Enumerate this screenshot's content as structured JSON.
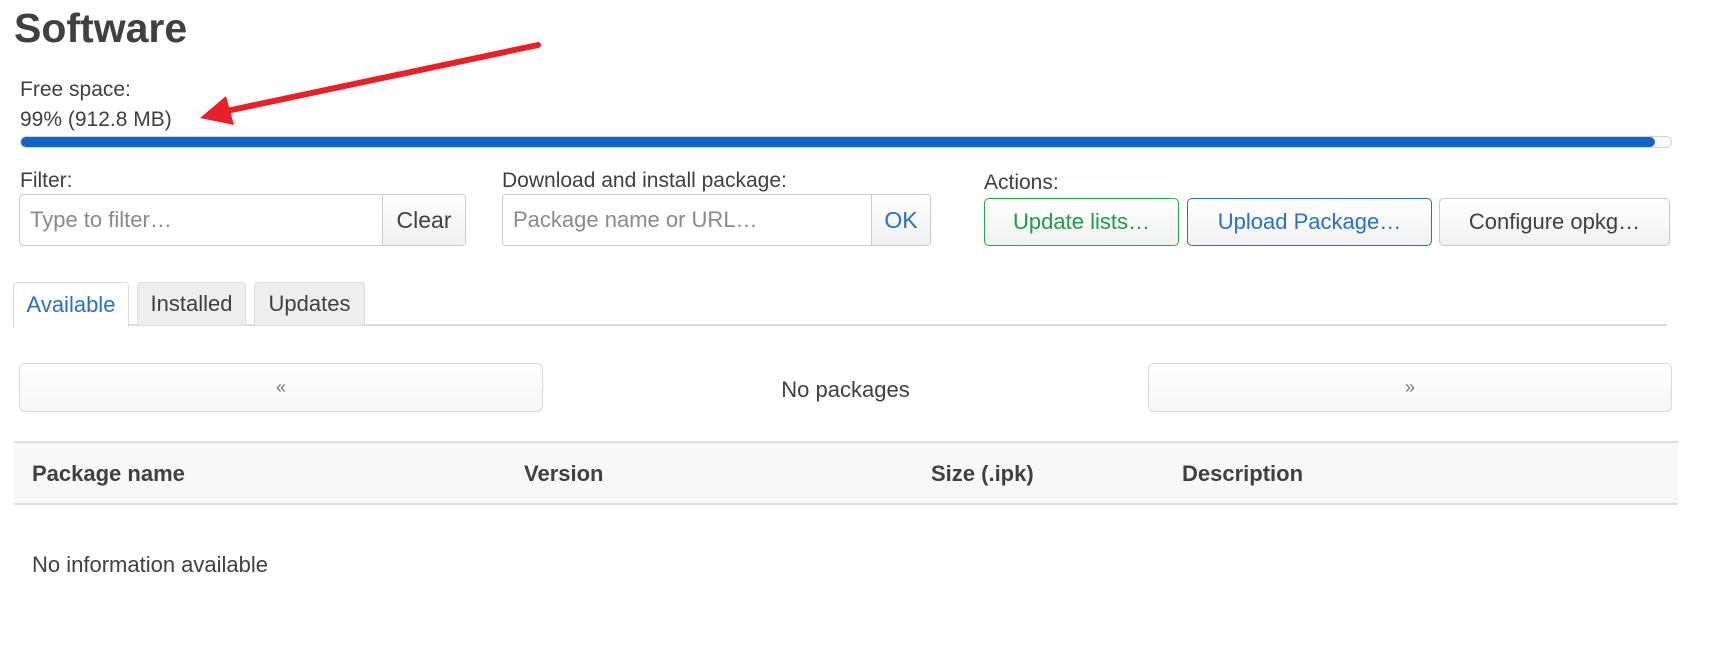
{
  "page": {
    "title": "Software"
  },
  "free_space": {
    "label": "Free space:",
    "value_text": "99% (912.8 MB)",
    "percent": 99,
    "bar_color": "#1565c0"
  },
  "filter": {
    "label": "Filter:",
    "placeholder": "Type to filter…",
    "value": "",
    "clear_label": "Clear"
  },
  "download": {
    "label": "Download and install package:",
    "placeholder": "Package name or URL…",
    "value": "",
    "ok_label": "OK"
  },
  "actions": {
    "label": "Actions:",
    "buttons": [
      {
        "label": "Update lists…",
        "color": "#1e9b45"
      },
      {
        "label": "Upload Package…",
        "color": "#2a6fc9"
      },
      {
        "label": "Configure opkg…",
        "color": "#404040"
      }
    ]
  },
  "tabs": [
    {
      "label": "Available",
      "active": true
    },
    {
      "label": "Installed",
      "active": false
    },
    {
      "label": "Updates",
      "active": false
    }
  ],
  "pager": {
    "prev_label": "«",
    "status": "No packages",
    "next_label": "»"
  },
  "table": {
    "columns": [
      "Package name",
      "Version",
      "Size (.ipk)",
      "Description"
    ],
    "empty_text": "No information available"
  },
  "annotation": {
    "type": "red-arrow",
    "color": "#e8202a",
    "points_to": "free-space-value"
  }
}
